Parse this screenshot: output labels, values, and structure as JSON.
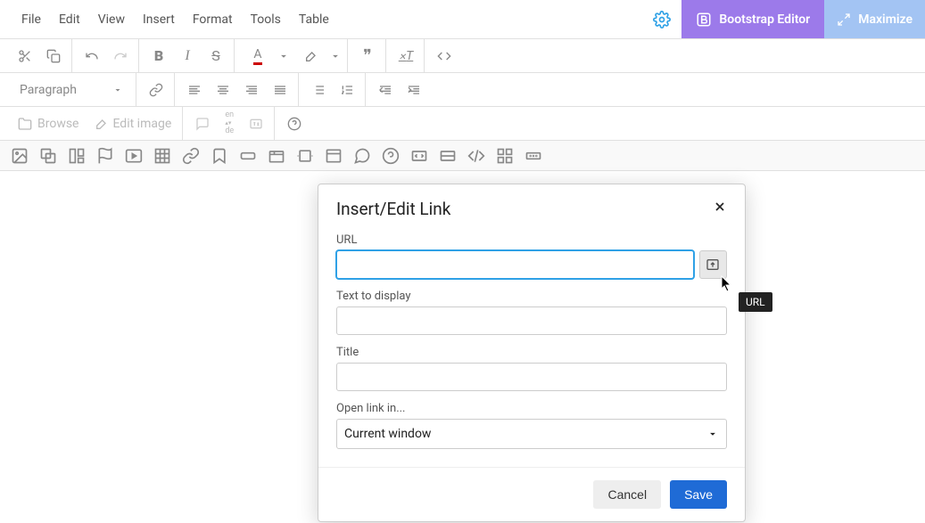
{
  "menubar": {
    "items": [
      "File",
      "Edit",
      "View",
      "Insert",
      "Format",
      "Tools",
      "Table"
    ],
    "bootstrap_label": "Bootstrap Editor",
    "maximize_label": "Maximize"
  },
  "toolbar": {
    "paragraph_label": "Paragraph",
    "browse_label": "Browse",
    "edit_image_label": "Edit image",
    "lang_top": "en",
    "lang_bottom": "de"
  },
  "modal": {
    "title": "Insert/Edit Link",
    "url_label": "URL",
    "url_value": "",
    "text_label": "Text to display",
    "text_value": "",
    "title_label": "Title",
    "title_value": "",
    "open_label": "Open link in...",
    "open_value": "Current window",
    "cancel_label": "Cancel",
    "save_label": "Save"
  },
  "tooltip": {
    "text": "URL"
  }
}
